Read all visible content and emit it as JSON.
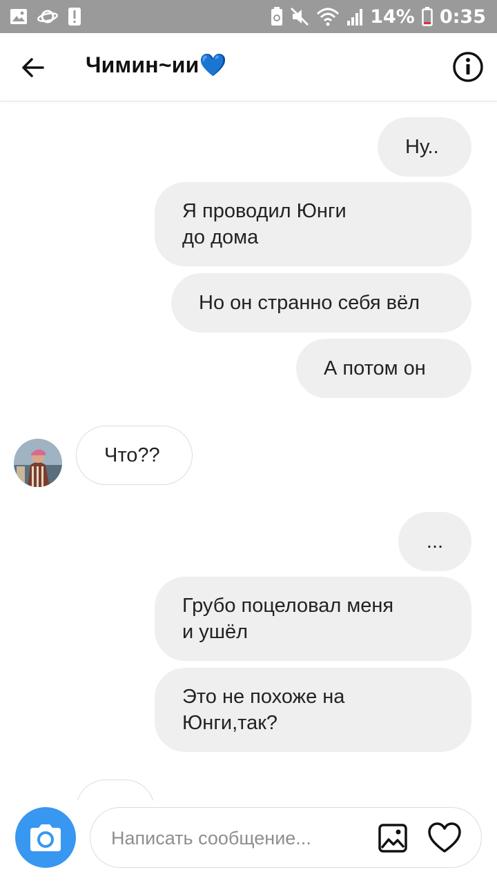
{
  "status_bar": {
    "battery_percent": "14%",
    "time": "0:35",
    "icons": [
      "image-icon",
      "planet-icon",
      "alert-icon",
      "battery-saver-icon",
      "mute-icon",
      "wifi-icon",
      "signal-icon",
      "battery-icon"
    ]
  },
  "header": {
    "title": "Чимин~ии💙",
    "back_icon": "arrow-left-icon",
    "info_icon": "info-icon"
  },
  "messages": [
    {
      "direction": "out",
      "text": "Ну.."
    },
    {
      "direction": "out",
      "text": "Я проводил Юнги\nдо дома"
    },
    {
      "direction": "out",
      "text": "Но он странно себя вёл"
    },
    {
      "direction": "out",
      "text": "А потом он"
    },
    {
      "direction": "in",
      "text": "Что??"
    },
    {
      "direction": "out",
      "text": "..."
    },
    {
      "direction": "out",
      "text": "Грубо поцеловал меня\nи ушёл"
    },
    {
      "direction": "out",
      "text": "Это не похоже на\nЮнги,так?"
    }
  ],
  "composer": {
    "placeholder": "Написать сообщение...",
    "camera_icon": "camera-icon",
    "gallery_icon": "gallery-icon",
    "like_icon": "heart-icon"
  },
  "colors": {
    "status_bar": "#9a9a9a",
    "outgoing_bubble": "#efeff0",
    "incoming_border": "#dbdbdb",
    "accent_blue": "#3897f0",
    "title_heart": "#2b9cf2"
  }
}
